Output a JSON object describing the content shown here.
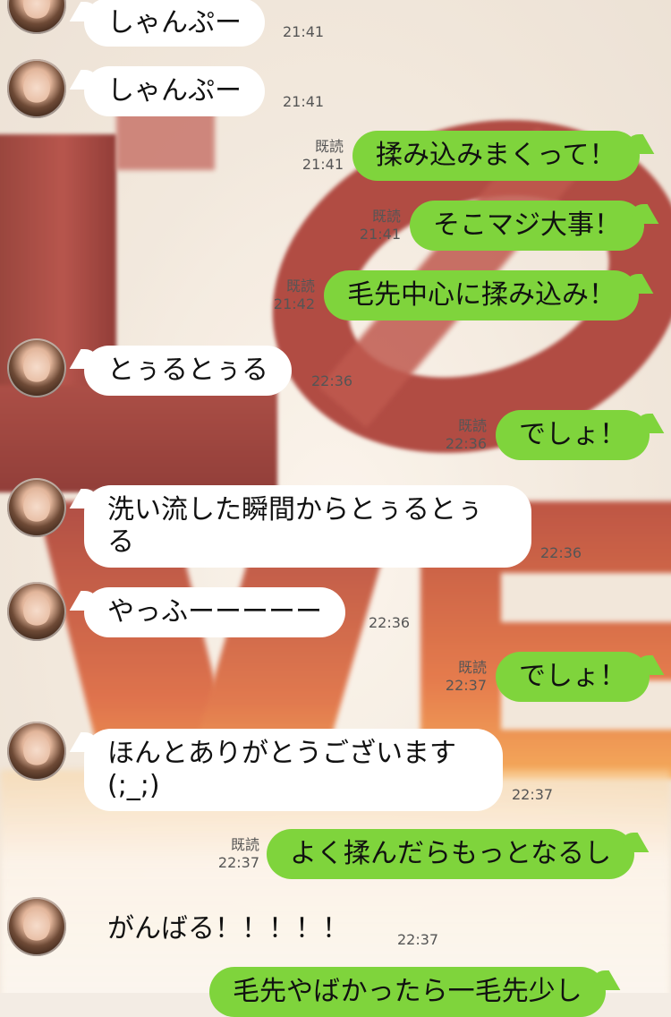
{
  "read_label": "既読",
  "messages": [
    {
      "dir": "in",
      "text": "しゃんぷー",
      "time": "21:41"
    },
    {
      "dir": "in",
      "text": "しゃんぷー",
      "time": "21:41"
    },
    {
      "dir": "out",
      "text": "揉み込みまくって！",
      "time": "21:41"
    },
    {
      "dir": "out",
      "text": "そこマジ大事！",
      "time": "21:41"
    },
    {
      "dir": "out",
      "text": "毛先中心に揉み込み！",
      "time": "21:42"
    },
    {
      "dir": "in",
      "text": "とぅるとぅる",
      "time": "22:36"
    },
    {
      "dir": "out",
      "text": "でしょ！",
      "time": "22:36"
    },
    {
      "dir": "in",
      "text": "洗い流した瞬間からとぅるとぅる",
      "time": "22:36"
    },
    {
      "dir": "in",
      "text": "やっふーーーーー",
      "time": "22:36"
    },
    {
      "dir": "out",
      "text": "でしょ！",
      "time": "22:37"
    },
    {
      "dir": "in",
      "text": "ほんとありがとうございます(;_;)",
      "time": "22:37"
    },
    {
      "dir": "out",
      "text": "よく揉んだらもっとなるし",
      "time": "22:37"
    },
    {
      "dir": "in",
      "text": "がんばる！！！！！",
      "time": "22:37"
    },
    {
      "dir": "out",
      "text": "毛先やばかったら一毛先少し",
      "time": ""
    }
  ],
  "colors": {
    "outgoing_bubble": "#7fd43c",
    "incoming_bubble": "#ffffff"
  }
}
